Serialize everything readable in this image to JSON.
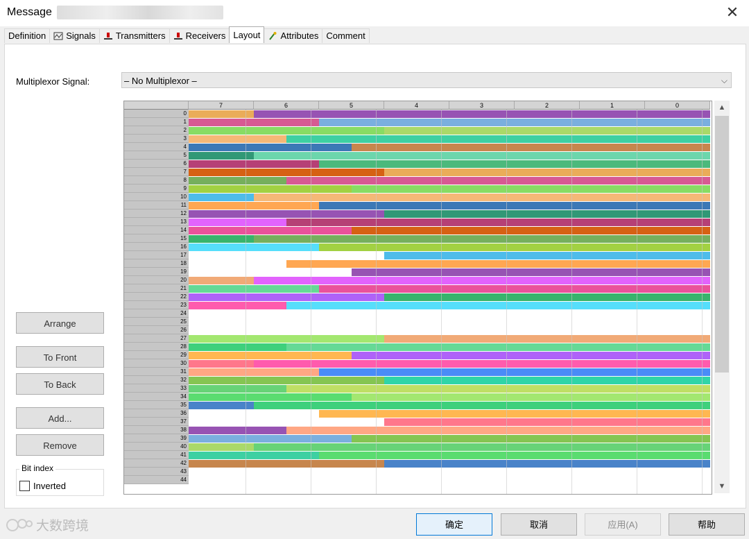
{
  "window": {
    "title": "Message",
    "close_glyph": "✕"
  },
  "tabs": [
    {
      "label": "Definition",
      "icon": null
    },
    {
      "label": "Signals",
      "icon": "signals-icon"
    },
    {
      "label": "Transmitters",
      "icon": "transmitter-icon"
    },
    {
      "label": "Receivers",
      "icon": "receiver-icon"
    },
    {
      "label": "Layout",
      "icon": null,
      "active": true
    },
    {
      "label": "Attributes",
      "icon": "attributes-icon"
    },
    {
      "label": "Comment",
      "icon": null
    }
  ],
  "multiplexor": {
    "label": "Multiplexor Signal:",
    "value": "– No Multiplexor –"
  },
  "side_buttons": {
    "arrange": "Arrange",
    "to_front": "To Front",
    "to_back": "To Back",
    "add": "Add...",
    "remove": "Remove"
  },
  "bit_index": {
    "group_label": "Bit index",
    "inverted_label": "Inverted",
    "inverted_checked": false
  },
  "grid": {
    "columns": [
      "7",
      "6",
      "5",
      "4",
      "3",
      "2",
      "1",
      "0"
    ],
    "rows": [
      "0",
      "1",
      "2",
      "3",
      "4",
      "5",
      "6",
      "7",
      "8",
      "9",
      "10",
      "11",
      "12",
      "13",
      "14",
      "15",
      "16",
      "17",
      "18",
      "19",
      "20",
      "21",
      "22",
      "23",
      "24",
      "25",
      "26",
      "27",
      "28",
      "29",
      "30",
      "31",
      "32",
      "33",
      "34",
      "35",
      "36",
      "37",
      "38",
      "39",
      "40",
      "41",
      "42",
      "43",
      "44"
    ]
  },
  "dialog_buttons": {
    "ok": "确定",
    "cancel": "取消",
    "apply": "应用(A)",
    "help": "帮助"
  },
  "watermark": "大数跨境",
  "colors": {
    "accent": "#0078d7"
  }
}
